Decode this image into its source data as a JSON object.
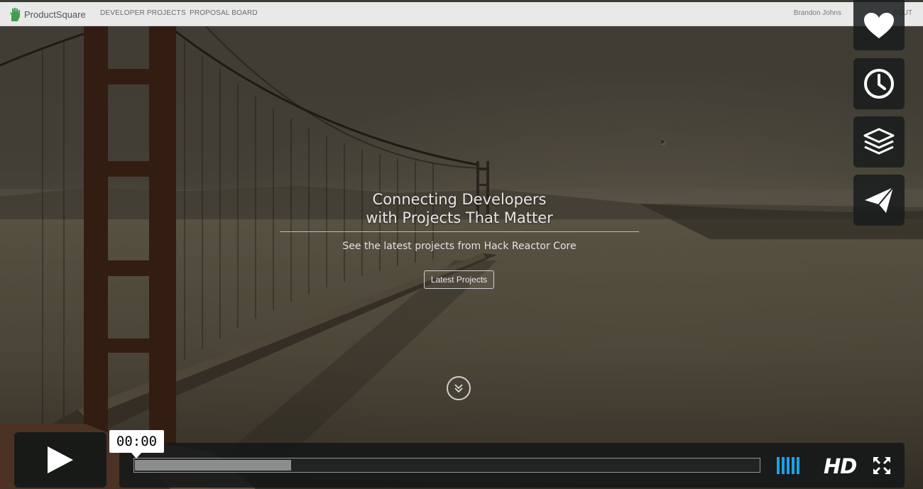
{
  "site": {
    "brand": "ProductSquare",
    "nav": [
      "DEVELOPER PROJECTS",
      "PROPOSAL BOARD"
    ],
    "user": "Brandon Johns",
    "user_action": "SCUT"
  },
  "hero": {
    "headline_line1": "Connecting Developers",
    "headline_line2": "with Projects That Matter",
    "subheading": "See the latest projects from Hack Reactor Core",
    "button": "Latest Projects"
  },
  "player": {
    "time": "00:00",
    "progress_loaded": 0.25,
    "quality": "HD",
    "side_buttons": [
      "heart-icon",
      "clock-icon",
      "layers-icon",
      "send-icon"
    ],
    "volume_level": 1.0,
    "accent": "#1aa3e8"
  }
}
